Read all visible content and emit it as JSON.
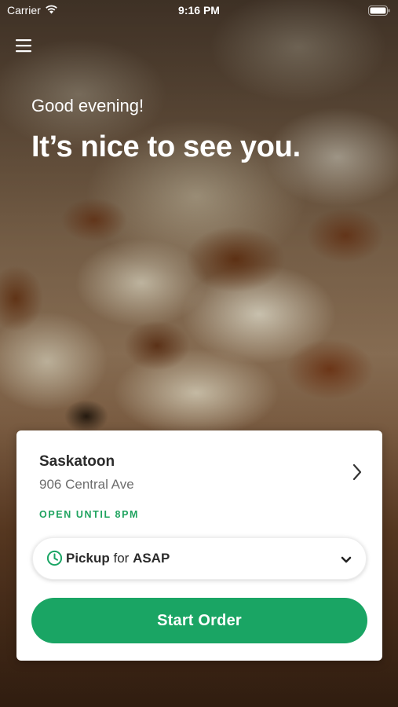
{
  "status_bar": {
    "carrier": "Carrier",
    "time": "9:16 PM",
    "icons": [
      "wifi-icon",
      "battery-icon"
    ]
  },
  "header": {
    "menu_icon": "hamburger-menu-icon",
    "greeting": "Good evening!",
    "headline": "It’s nice to see you."
  },
  "store": {
    "name": "Saskatoon",
    "address": "906 Central Ave",
    "hours": "OPEN UNTIL 8PM",
    "chevron_icon": "chevron-right-icon"
  },
  "order_type": {
    "icon": "clock-icon",
    "mode": "Pickup",
    "connector": "for",
    "time": "ASAP",
    "caret_icon": "chevron-down-icon"
  },
  "actions": {
    "start_order_label": "Start Order"
  },
  "colors": {
    "accent_green": "#1aa564",
    "hours_green": "#1fa35f",
    "card_bg": "#ffffff",
    "text_dark": "#2b2b2b",
    "text_muted": "#6d6d6d"
  }
}
